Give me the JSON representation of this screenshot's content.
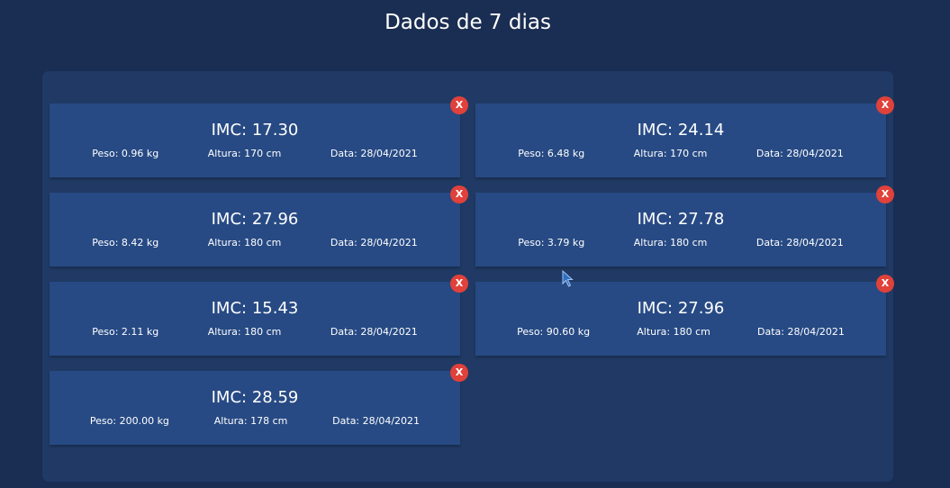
{
  "page": {
    "title": "Dados de 7 dias"
  },
  "records": [
    {
      "imc": "IMC: 17.30",
      "peso": "Peso: 0.96 kg",
      "altura": "Altura: 170 cm",
      "data": "Data: 28/04/2021",
      "delete_label": "X"
    },
    {
      "imc": "IMC: 24.14",
      "peso": "Peso: 6.48 kg",
      "altura": "Altura: 170 cm",
      "data": "Data: 28/04/2021",
      "delete_label": "X"
    },
    {
      "imc": "IMC: 27.96",
      "peso": "Peso: 8.42 kg",
      "altura": "Altura: 180 cm",
      "data": "Data: 28/04/2021",
      "delete_label": "X"
    },
    {
      "imc": "IMC: 27.78",
      "peso": "Peso: 3.79 kg",
      "altura": "Altura: 180 cm",
      "data": "Data: 28/04/2021",
      "delete_label": "X"
    },
    {
      "imc": "IMC: 15.43",
      "peso": "Peso: 2.11 kg",
      "altura": "Altura: 180 cm",
      "data": "Data: 28/04/2021",
      "delete_label": "X"
    },
    {
      "imc": "IMC: 27.96",
      "peso": "Peso: 90.60 kg",
      "altura": "Altura: 180 cm",
      "data": "Data: 28/04/2021",
      "delete_label": "X"
    },
    {
      "imc": "IMC: 28.59",
      "peso": "Peso: 200.00 kg",
      "altura": "Altura: 178 cm",
      "data": "Data: 28/04/2021",
      "delete_label": "X"
    }
  ],
  "colors": {
    "background": "#1a2d52",
    "panel": "#203a65",
    "card": "#274a84",
    "delete": "#e0413a"
  },
  "icons": {
    "cursor": "mouse-pointer-icon"
  }
}
